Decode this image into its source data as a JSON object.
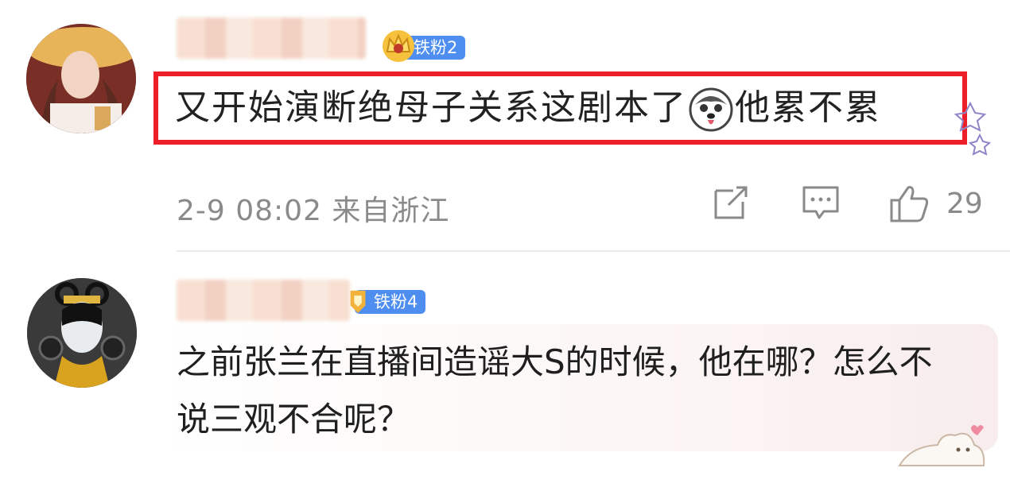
{
  "comments": [
    {
      "badge_label": "铁粉2",
      "text_before": "又开始演断绝母子关系这剧本了",
      "text_after": "他累不累",
      "emoji_icon": "husky-emoji-icon",
      "meta": "2-9 08:02 来自浙江",
      "like_count": "29",
      "highlight_color": "#ef1f2a"
    },
    {
      "badge_label": "铁粉4",
      "text": "之前张兰在直播间造谣大S的时候，他在哪？怎么不说三观不合呢？"
    }
  ],
  "colors": {
    "badge_blue": "#4d8ef0",
    "meta_gray": "#8a8a8a"
  }
}
